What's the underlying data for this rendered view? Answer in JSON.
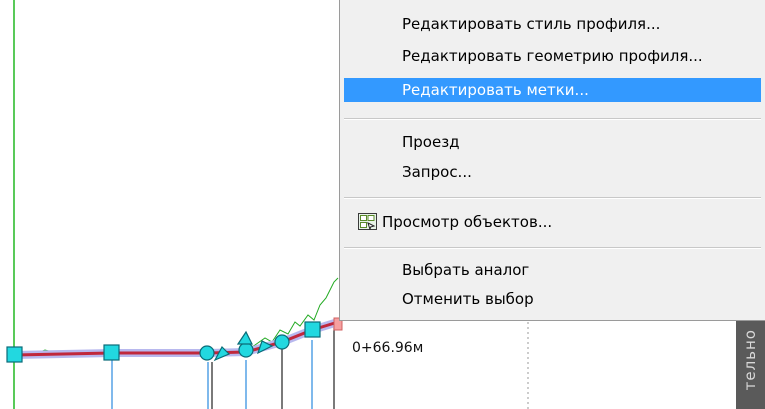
{
  "context_menu": {
    "items": [
      {
        "label": "Редактировать стиль профиля...",
        "highlighted": false
      },
      {
        "label": "Редактировать геометрию профиля...",
        "highlighted": false
      },
      {
        "label": "Редактировать метки...",
        "highlighted": true
      },
      {
        "label": "Проезд",
        "highlighted": false
      },
      {
        "label": "Запрос...",
        "highlighted": false
      },
      {
        "label": "Просмотр объектов...",
        "icon": "object-viewer-icon",
        "highlighted": false
      },
      {
        "label": "Выбрать аналог",
        "highlighted": false
      },
      {
        "label": "Отменить выбор",
        "highlighted": false
      }
    ]
  },
  "drawing": {
    "station_label": "0+66.96м",
    "colors": {
      "profile_line": "#c0283c",
      "profile_highlight": "#b8b8ee",
      "terrain_line": "#22aa22",
      "grips": "#22d8e0",
      "vertical_lines": "#2a8ae0",
      "left_border": "#22b822"
    }
  },
  "side_panel": {
    "tab_label": "тельно"
  }
}
